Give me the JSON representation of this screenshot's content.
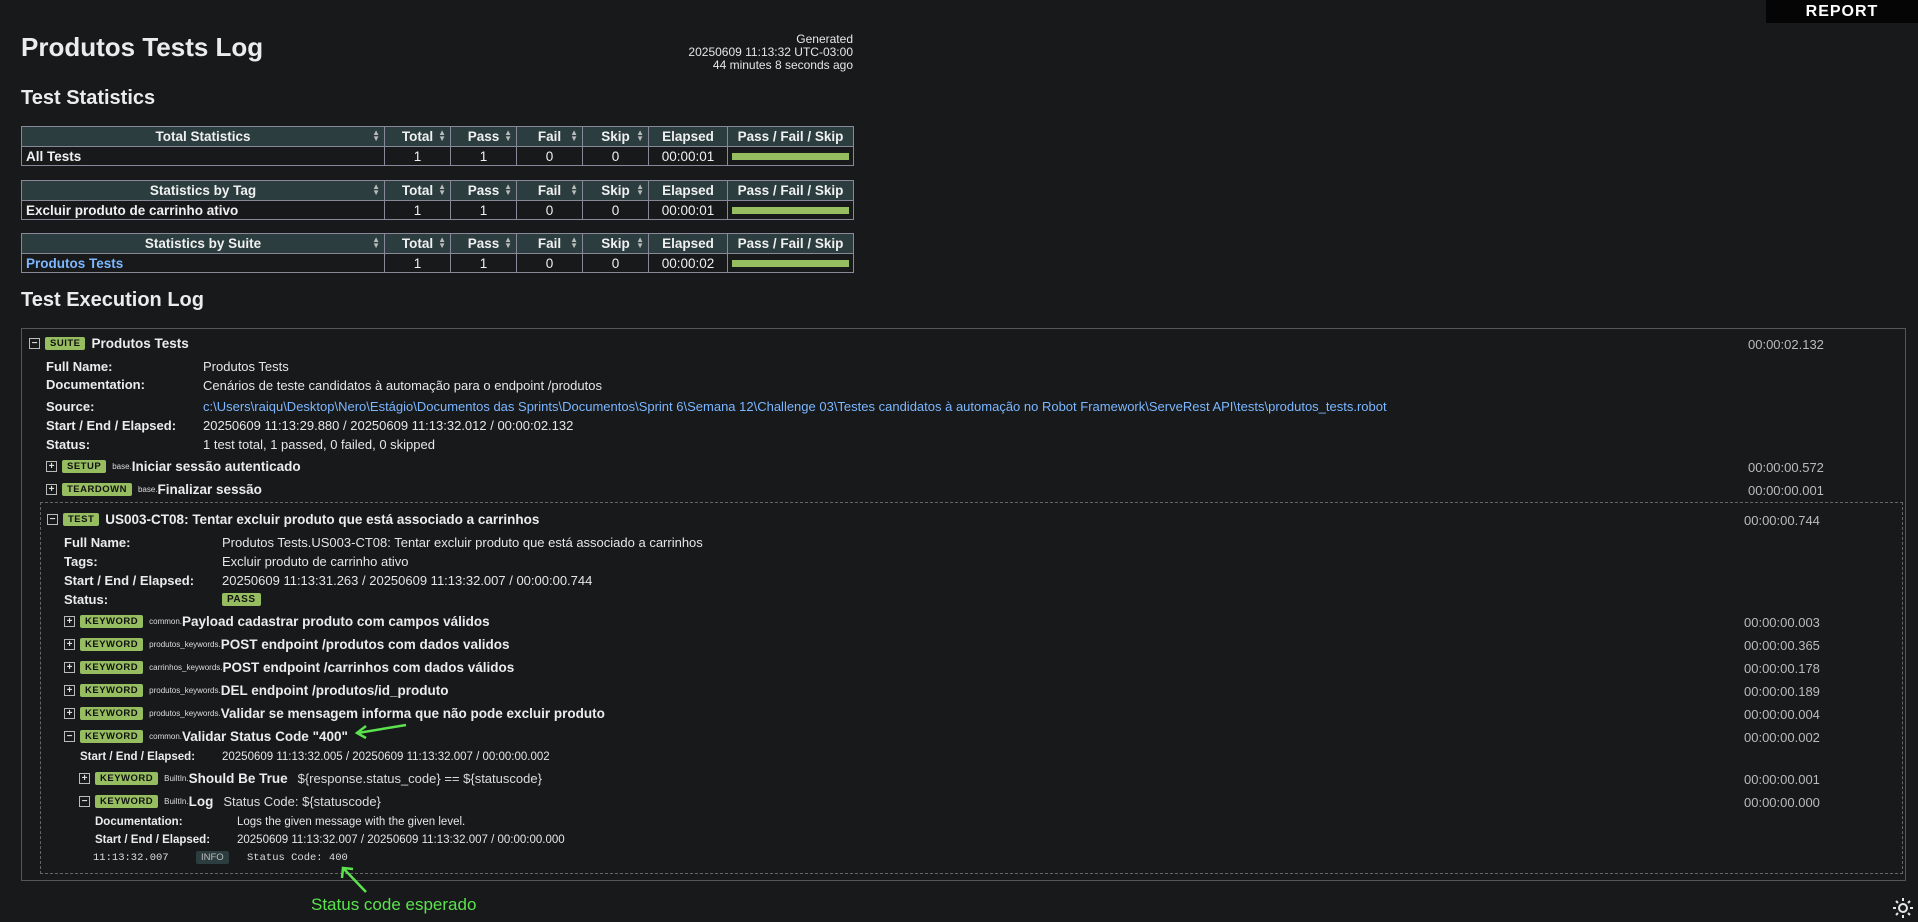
{
  "report_label": "REPORT",
  "generated": {
    "label": "Generated",
    "datetime": "20250609 11:13:32 UTC-03:00",
    "ago": "44 minutes 8 seconds ago"
  },
  "title": "Produtos Tests Log",
  "stats_heading": "Test Statistics",
  "stats_columns": [
    "Total",
    "Pass",
    "Fail",
    "Skip",
    "Elapsed",
    "Pass / Fail / Skip"
  ],
  "stats_tables": [
    {
      "header": "Total Statistics",
      "rows": [
        {
          "name": "All Tests",
          "total": "1",
          "pass": "1",
          "fail": "0",
          "skip": "0",
          "elapsed": "00:00:01",
          "pass_ratio": 1
        }
      ]
    },
    {
      "header": "Statistics by Tag",
      "rows": [
        {
          "name": "Excluir produto de carrinho ativo",
          "total": "1",
          "pass": "1",
          "fail": "0",
          "skip": "0",
          "elapsed": "00:00:01",
          "pass_ratio": 1
        }
      ]
    },
    {
      "header": "Statistics by Suite",
      "rows": [
        {
          "name": "Produtos Tests",
          "total": "1",
          "pass": "1",
          "fail": "0",
          "skip": "0",
          "elapsed": "00:00:02",
          "pass_ratio": 1
        }
      ]
    }
  ],
  "exec_heading": "Test Execution Log",
  "suite": {
    "label": "SUITE",
    "name": "Produtos Tests",
    "time": "00:00:02.132",
    "meta": [
      {
        "k": "Full Name:",
        "v": "Produtos Tests"
      },
      {
        "k": "Documentation:",
        "v": "Cenários de teste candidatos à automação para o endpoint /produtos"
      },
      {
        "k": "Source:",
        "v": "c:\\Users\\raiqu\\Desktop\\Nero\\Estágio\\Documentos das Sprints\\Documentos\\Sprint 6\\Semana 12\\Challenge 03\\Testes candidatos à automação no Robot Framework\\ServeRest API\\tests\\produtos_tests.robot"
      },
      {
        "k": "Start / End / Elapsed:",
        "v": "20250609 11:13:29.880 / 20250609 11:13:32.012 / 00:00:02.132"
      },
      {
        "k": "Status:",
        "v": "1 test total, 1 passed, 0 failed, 0 skipped"
      }
    ],
    "setup": {
      "label": "SETUP",
      "lib": "base.",
      "name": "Iniciar sessão autenticado",
      "time": "00:00:00.572"
    },
    "teardown": {
      "label": "TEARDOWN",
      "lib": "base.",
      "name": "Finalizar sessão",
      "time": "00:00:00.001"
    }
  },
  "test": {
    "label": "TEST",
    "name": "US003-CT08: Tentar excluir produto que está associado a carrinhos",
    "time": "00:00:00.744",
    "meta": [
      {
        "k": "Full Name:",
        "v": "Produtos Tests.US003-CT08: Tentar excluir produto que está associado a carrinhos"
      },
      {
        "k": "Tags:",
        "v": "Excluir produto de carrinho ativo"
      },
      {
        "k": "Start / End / Elapsed:",
        "v": "20250609 11:13:31.263 / 20250609 11:13:32.007 / 00:00:00.744"
      },
      {
        "k": "Status:",
        "v": ""
      }
    ],
    "status": "PASS",
    "keywords": [
      {
        "lib": "common.",
        "name": "Payload cadastrar produto com campos válidos",
        "time": "00:00:00.003"
      },
      {
        "lib": "produtos_keywords.",
        "name": "POST endpoint /produtos com dados validos",
        "time": "00:00:00.365"
      },
      {
        "lib": "carrinhos_keywords.",
        "name": "POST endpoint /carrinhos com dados válidos",
        "time": "00:00:00.178"
      },
      {
        "lib": "produtos_keywords.",
        "name": "DEL endpoint /produtos/id_produto",
        "time": "00:00:00.189"
      },
      {
        "lib": "produtos_keywords.",
        "name": "Validar se mensagem informa que não pode excluir produto",
        "time": "00:00:00.004"
      },
      {
        "lib": "common.",
        "name": "Validar Status Code \"400\"",
        "time": "00:00:00.002"
      }
    ],
    "kw_label": "KEYWORD",
    "validar": {
      "meta_k": "Start / End / Elapsed:",
      "meta_v": "20250609 11:13:32.005 / 20250609 11:13:32.007 / 00:00:00.002",
      "child1": {
        "lib": "BuiltIn.",
        "name": "Should Be True",
        "args": "${response.status_code} == ${statuscode}",
        "time": "00:00:00.001"
      },
      "child2": {
        "lib": "BuiltIn.",
        "name": "Log",
        "args": "Status Code: ${statuscode}",
        "time": "00:00:00.000",
        "doc_k": "Documentation:",
        "doc_v": "Logs the given message with the given level.",
        "sel_k": "Start / End / Elapsed:",
        "sel_v": "20250609 11:13:32.007 / 20250609 11:13:32.007 / 00:00:00.000",
        "msg_time": "11:13:32.007",
        "msg_level": "INFO",
        "msg_text": "Status Code: 400"
      }
    }
  },
  "annotation": "Status code esperado",
  "colors": {
    "pass": "#97bd61",
    "background": "#17191b",
    "header": "#2c3d3f",
    "annotation": "#5be34d"
  }
}
